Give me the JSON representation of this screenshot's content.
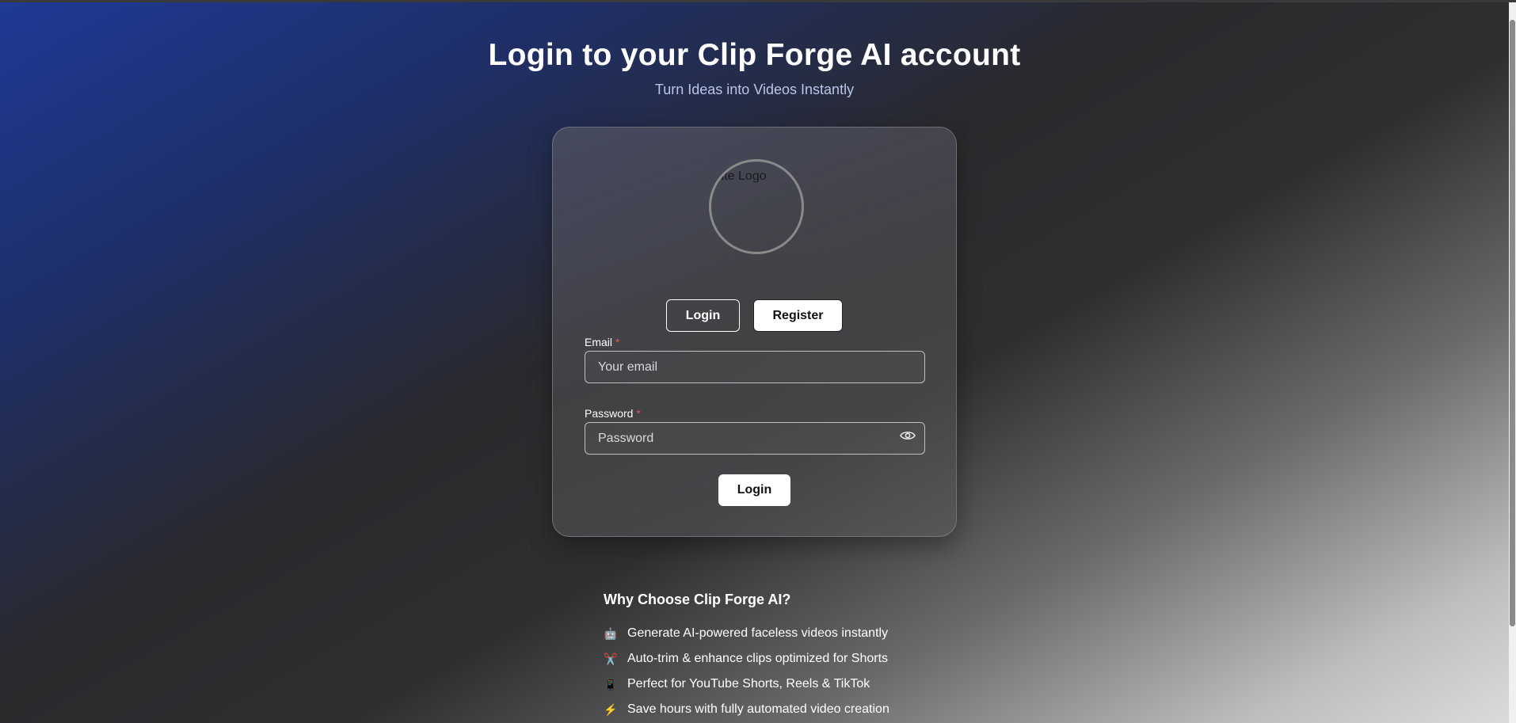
{
  "header": {
    "title": "Login to your Clip Forge AI account",
    "subtitle": "Turn Ideas into Videos Instantly"
  },
  "card": {
    "logo_alt": "Site Logo",
    "tabs": {
      "login": "Login",
      "register": "Register"
    },
    "email": {
      "label": "Email",
      "required_mark": "*",
      "placeholder": "Your email",
      "value": ""
    },
    "password": {
      "label": "Password",
      "required_mark": "*",
      "placeholder": "Password",
      "value": "",
      "toggle_icon": "eye-icon"
    },
    "submit_label": "Login"
  },
  "why": {
    "title": "Why Choose Clip Forge AI?",
    "features": [
      {
        "icon": "🤖",
        "icon_name": "robot-icon",
        "text": "Generate AI-powered faceless videos instantly"
      },
      {
        "icon": "✂️",
        "icon_name": "scissors-icon",
        "text": "Auto-trim & enhance clips optimized for Shorts"
      },
      {
        "icon": "📱",
        "icon_name": "phone-icon",
        "text": "Perfect for YouTube Shorts, Reels & TikTok"
      },
      {
        "icon": "⚡",
        "icon_name": "lightning-icon",
        "text": "Save hours with fully automated video creation"
      }
    ]
  },
  "colors": {
    "background_start": "#1f3a95",
    "background_end": "#dcdcdc",
    "required": "#e05555",
    "subtitle": "#b9c6ea"
  }
}
